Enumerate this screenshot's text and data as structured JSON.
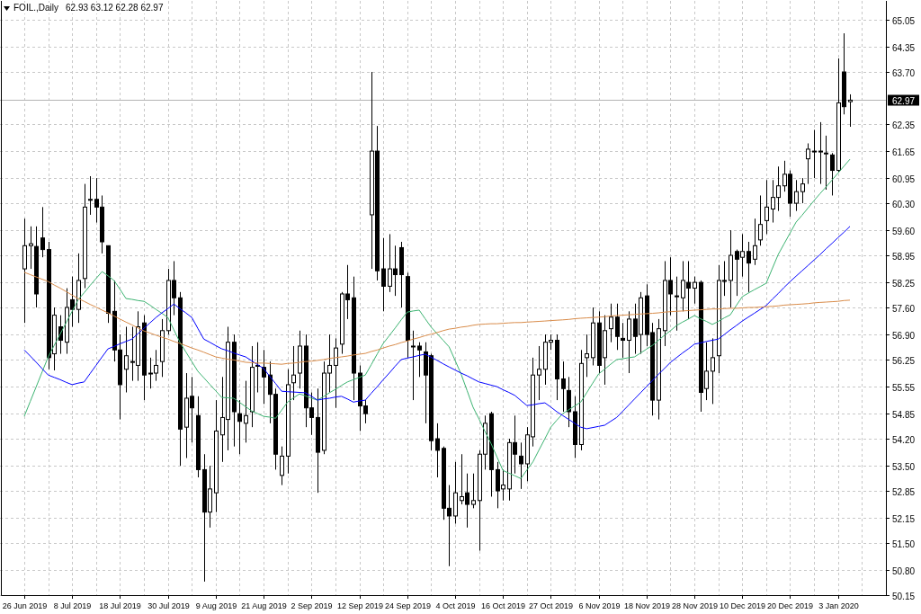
{
  "chart": {
    "header": {
      "symbol": "FOIL.,Daily",
      "quote": "62.93 63.12 62.28 62.97"
    },
    "chart_data": {
      "type": "candlestick",
      "grid": true,
      "ylim": [
        50.15,
        65.54
      ],
      "categories": [
        "26 Jun 2019",
        null,
        null,
        null,
        null,
        null,
        null,
        null,
        "8 Jul 2019",
        null,
        null,
        null,
        null,
        null,
        null,
        null,
        "18 Jul 2019",
        null,
        null,
        null,
        null,
        null,
        null,
        null,
        "30 Jul 2019",
        null,
        null,
        null,
        null,
        null,
        null,
        null,
        "9 Aug 2019",
        null,
        null,
        null,
        null,
        null,
        null,
        null,
        "21 Aug 2019",
        null,
        null,
        null,
        null,
        null,
        null,
        null,
        "2 Sep 2019",
        null,
        null,
        null,
        null,
        null,
        null,
        null,
        "12 Sep 2019",
        null,
        null,
        null,
        null,
        null,
        null,
        null,
        "24 Sep 2019",
        null,
        null,
        null,
        null,
        null,
        null,
        null,
        "4 Oct 2019",
        null,
        null,
        null,
        null,
        null,
        null,
        null,
        "16 Oct 2019",
        null,
        null,
        null,
        null,
        null,
        null,
        null,
        "27 Oct 2019",
        null,
        null,
        null,
        null,
        null,
        null,
        null,
        "6 Nov 2019",
        null,
        null,
        null,
        null,
        null,
        null,
        null,
        "18 Nov 2019",
        null,
        null,
        null,
        null,
        null,
        null,
        null,
        "28 Nov 2019",
        null,
        null,
        null,
        null,
        null,
        null,
        null,
        "10 Dec 2019",
        null,
        null,
        null,
        null,
        null,
        null,
        null,
        "20 Dec 2019",
        null,
        null,
        null,
        null,
        null,
        null,
        null,
        "3 Jan 2020",
        null,
        null
      ],
      "yticks": [
        {
          "value": 65.05,
          "label": "65.05"
        },
        {
          "value": 64.35,
          "label": "64.35"
        },
        {
          "value": 63.7,
          "label": "63.70"
        },
        {
          "value": 62.35,
          "label": "62.35"
        },
        {
          "value": 61.65,
          "label": "61.65"
        },
        {
          "value": 60.95,
          "label": "60.95"
        },
        {
          "value": 60.3,
          "label": "60.30"
        },
        {
          "value": 59.6,
          "label": "59.60"
        },
        {
          "value": 58.95,
          "label": "58.95"
        },
        {
          "value": 58.25,
          "label": "58.25"
        },
        {
          "value": 57.6,
          "label": "57.60"
        },
        {
          "value": 56.9,
          "label": "56.90"
        },
        {
          "value": 56.25,
          "label": "56.25"
        },
        {
          "value": 55.55,
          "label": "55.55"
        },
        {
          "value": 54.85,
          "label": "54.85"
        },
        {
          "value": 54.2,
          "label": "54.20"
        },
        {
          "value": 53.5,
          "label": "53.50"
        },
        {
          "value": 52.85,
          "label": "52.85"
        },
        {
          "value": 52.15,
          "label": "52.15"
        },
        {
          "value": 51.5,
          "label": "51.50"
        },
        {
          "value": 50.8,
          "label": "50.80"
        },
        {
          "value": 50.15,
          "label": "50.15"
        }
      ],
      "ref_lines": [
        {
          "axis": "y",
          "value": 62.97,
          "label": "62.97"
        }
      ],
      "ohlc": [
        [
          58.6,
          59.9,
          57.2,
          59.2
        ],
        [
          59.2,
          59.7,
          58.6,
          59.25
        ],
        [
          59.18,
          59.7,
          57.6,
          57.95
        ],
        [
          59.4,
          60.2,
          58.9,
          59.1
        ],
        [
          59.1,
          59.3,
          56.0,
          56.3
        ],
        [
          56.4,
          57.6,
          55.97,
          57.4
        ],
        [
          57.1,
          57.4,
          56.4,
          56.75
        ],
        [
          56.7,
          58.1,
          56.4,
          57.6
        ],
        [
          57.8,
          58.4,
          57.1,
          57.55
        ],
        [
          57.55,
          59.0,
          57.2,
          58.3
        ],
        [
          58.35,
          60.8,
          58.1,
          60.2
        ],
        [
          60.4,
          61.0,
          60.0,
          60.4
        ],
        [
          60.4,
          60.95,
          59.8,
          60.2
        ],
        [
          60.2,
          60.5,
          59.0,
          59.3
        ],
        [
          59.2,
          59.2,
          57.2,
          57.45
        ],
        [
          57.5,
          58.3,
          56.2,
          56.5
        ],
        [
          56.5,
          56.9,
          54.7,
          55.6
        ],
        [
          56.0,
          57.1,
          55.4,
          56.35
        ],
        [
          56.2,
          57.1,
          55.7,
          56.2
        ],
        [
          56.1,
          57.5,
          55.7,
          57.1
        ],
        [
          57.2,
          57.4,
          55.2,
          55.85
        ],
        [
          55.9,
          56.3,
          55.5,
          55.9
        ],
        [
          55.9,
          56.5,
          55.7,
          56.1
        ],
        [
          56.2,
          57.3,
          55.8,
          57.0
        ],
        [
          57.0,
          58.6,
          56.9,
          58.3
        ],
        [
          58.3,
          58.8,
          57.4,
          57.85
        ],
        [
          57.85,
          58.0,
          53.5,
          54.45
        ],
        [
          54.5,
          55.9,
          53.7,
          55.25
        ],
        [
          55.3,
          55.8,
          54.1,
          55.0
        ],
        [
          54.8,
          55.3,
          53.2,
          53.4
        ],
        [
          53.4,
          53.8,
          50.5,
          52.3
        ],
        [
          52.3,
          53.5,
          51.9,
          52.9
        ],
        [
          52.8,
          55.2,
          52.3,
          54.4
        ],
        [
          54.3,
          55.8,
          53.6,
          54.75
        ],
        [
          54.7,
          57.1,
          53.9,
          56.7
        ],
        [
          56.7,
          56.9,
          54.0,
          54.9
        ],
        [
          54.85,
          55.2,
          53.8,
          54.65
        ],
        [
          54.6,
          55.7,
          54.1,
          54.8
        ],
        [
          54.9,
          56.6,
          54.5,
          56.05
        ],
        [
          56.1,
          56.7,
          55.4,
          56.1
        ],
        [
          56.05,
          56.5,
          55.1,
          55.8
        ],
        [
          55.85,
          56.2,
          54.6,
          55.35
        ],
        [
          55.35,
          55.5,
          53.4,
          53.8
        ],
        [
          53.25,
          54.0,
          53.0,
          53.75
        ],
        [
          53.75,
          56.0,
          53.3,
          55.6
        ],
        [
          55.65,
          56.6,
          55.2,
          55.85
        ],
        [
          55.9,
          57.0,
          55.5,
          56.6
        ],
        [
          56.6,
          56.9,
          54.5,
          55.0
        ],
        [
          55.0,
          55.4,
          54.3,
          54.75
        ],
        [
          54.75,
          55.5,
          52.8,
          53.85
        ],
        [
          53.9,
          56.2,
          53.8,
          55.9
        ],
        [
          55.9,
          56.9,
          55.4,
          56.1
        ],
        [
          56.1,
          56.8,
          55.0,
          56.55
        ],
        [
          56.65,
          58.0,
          56.4,
          57.95
        ],
        [
          57.95,
          58.7,
          57.3,
          57.8
        ],
        [
          57.85,
          58.4,
          55.2,
          55.9
        ],
        [
          55.9,
          56.1,
          54.4,
          55.05
        ],
        [
          55.05,
          55.2,
          54.6,
          54.85
        ],
        [
          60.0,
          63.7,
          58.6,
          61.65
        ],
        [
          61.65,
          62.3,
          58.3,
          58.55
        ],
        [
          58.6,
          59.4,
          57.5,
          58.15
        ],
        [
          58.15,
          59.5,
          58.0,
          58.6
        ],
        [
          58.6,
          59.2,
          57.9,
          58.45
        ],
        [
          59.15,
          59.3,
          57.6,
          58.45
        ],
        [
          58.4,
          58.5,
          56.3,
          56.75
        ],
        [
          56.6,
          57.0,
          55.2,
          56.6
        ],
        [
          56.6,
          56.7,
          55.8,
          56.5
        ],
        [
          56.45,
          56.7,
          54.6,
          55.85
        ],
        [
          56.35,
          56.4,
          53.9,
          54.15
        ],
        [
          54.2,
          54.6,
          53.2,
          53.9
        ],
        [
          53.95,
          54.0,
          52.1,
          52.4
        ],
        [
          52.4,
          53.0,
          50.9,
          52.2
        ],
        [
          52.2,
          53.6,
          52.0,
          52.8
        ],
        [
          52.6,
          53.8,
          52.5,
          52.7
        ],
        [
          52.8,
          53.3,
          51.9,
          52.5
        ],
        [
          52.5,
          53.3,
          52.4,
          52.6
        ],
        [
          52.6,
          53.9,
          51.3,
          53.8
        ],
        [
          53.8,
          54.8,
          53.4,
          54.6
        ],
        [
          54.85,
          54.9,
          52.7,
          53.4
        ],
        [
          53.4,
          53.6,
          52.4,
          52.85
        ],
        [
          52.9,
          53.4,
          52.6,
          53.0
        ],
        [
          52.9,
          54.2,
          52.6,
          54.1
        ],
        [
          54.1,
          54.8,
          53.3,
          53.8
        ],
        [
          53.75,
          54.1,
          52.9,
          53.55
        ],
        [
          53.55,
          54.5,
          53.1,
          54.3
        ],
        [
          54.25,
          56.3,
          54.0,
          55.85
        ],
        [
          55.85,
          56.6,
          55.2,
          56.0
        ],
        [
          56.0,
          56.9,
          55.6,
          56.7
        ],
        [
          56.7,
          56.9,
          56.5,
          56.75
        ],
        [
          56.75,
          56.9,
          55.2,
          55.75
        ],
        [
          55.75,
          56.2,
          54.9,
          55.5
        ],
        [
          55.45,
          55.8,
          54.5,
          54.9
        ],
        [
          54.9,
          55.3,
          53.7,
          54.05
        ],
        [
          54.05,
          56.5,
          53.9,
          56.15
        ],
        [
          56.3,
          56.9,
          55.8,
          56.4
        ],
        [
          56.3,
          57.6,
          56.1,
          57.2
        ],
        [
          57.2,
          57.5,
          55.9,
          56.1
        ],
        [
          56.3,
          57.4,
          55.6,
          57.0
        ],
        [
          57.05,
          57.7,
          56.7,
          57.35
        ],
        [
          57.35,
          57.7,
          56.5,
          56.85
        ],
        [
          56.8,
          57.2,
          56.3,
          56.75
        ],
        [
          56.75,
          57.5,
          55.9,
          57.3
        ],
        [
          57.3,
          57.7,
          56.4,
          56.85
        ],
        [
          56.9,
          58.0,
          56.4,
          57.85
        ],
        [
          57.9,
          58.2,
          56.6,
          56.9
        ],
        [
          56.95,
          57.2,
          54.8,
          55.2
        ],
        [
          55.2,
          57.3,
          54.7,
          57.05
        ],
        [
          57.0,
          58.8,
          56.6,
          58.3
        ],
        [
          58.3,
          58.9,
          57.4,
          57.95
        ],
        [
          57.9,
          58.4,
          57.0,
          57.9
        ],
        [
          57.85,
          58.8,
          57.5,
          58.3
        ],
        [
          58.25,
          58.8,
          57.3,
          58.1
        ],
        [
          58.1,
          58.4,
          57.7,
          58.25
        ],
        [
          58.25,
          58.3,
          54.9,
          55.4
        ],
        [
          55.5,
          56.7,
          55.2,
          55.95
        ],
        [
          55.95,
          56.8,
          55.1,
          56.3
        ],
        [
          56.35,
          58.7,
          55.9,
          58.3
        ],
        [
          58.3,
          58.8,
          57.9,
          58.3
        ],
        [
          58.3,
          59.6,
          57.6,
          58.95
        ],
        [
          59.05,
          59.1,
          57.9,
          58.85
        ],
        [
          58.9,
          59.5,
          58.4,
          59.05
        ],
        [
          59.05,
          59.3,
          58.0,
          58.75
        ],
        [
          58.85,
          59.9,
          58.7,
          59.2
        ],
        [
          59.35,
          60.5,
          59.2,
          59.75
        ],
        [
          59.85,
          60.9,
          59.5,
          60.2
        ],
        [
          60.15,
          60.9,
          59.8,
          60.45
        ],
        [
          60.45,
          61.25,
          60.1,
          60.75
        ],
        [
          60.75,
          61.4,
          60.6,
          61.05
        ],
        [
          61.05,
          61.15,
          59.95,
          60.3
        ],
        [
          60.3,
          60.9,
          60.1,
          60.6
        ],
        [
          60.6,
          60.95,
          60.3,
          60.8
        ],
        [
          61.45,
          61.85,
          60.8,
          61.7
        ],
        [
          61.65,
          62.2,
          60.95,
          61.65
        ],
        [
          61.65,
          62.4,
          60.8,
          61.65
        ],
        [
          61.6,
          62.05,
          60.65,
          61.6
        ],
        [
          61.55,
          61.6,
          60.5,
          61.15
        ],
        [
          61.15,
          64.05,
          61.1,
          62.9
        ],
        [
          63.7,
          64.7,
          62.6,
          62.8
        ],
        [
          62.93,
          63.12,
          62.28,
          62.97
        ]
      ],
      "series": [
        {
          "type": "line",
          "color": "#3cb371",
          "values": [
            54.78,
            55.17,
            55.55,
            55.94,
            56.32,
            56.62,
            56.91,
            57.21,
            57.5,
            57.8,
            57.98,
            58.17,
            58.35,
            58.53,
            58.42,
            58.3,
            58.07,
            57.83,
            57.81,
            57.78,
            57.76,
            57.66,
            57.55,
            57.45,
            57.34,
            57.02,
            56.7,
            56.45,
            56.2,
            55.95,
            55.78,
            55.61,
            55.44,
            55.27,
            55.26,
            55.25,
            55.14,
            55.03,
            54.92,
            54.85,
            54.78,
            54.76,
            54.73,
            54.94,
            55.15,
            55.26,
            55.36,
            55.31,
            55.25,
            55.2,
            55.29,
            55.39,
            55.48,
            55.58,
            55.67,
            55.73,
            55.79,
            55.85,
            56.12,
            56.4,
            56.67,
            56.87,
            57.07,
            57.28,
            57.48,
            57.51,
            57.53,
            57.31,
            57.09,
            56.92,
            56.75,
            56.58,
            56.23,
            55.88,
            55.45,
            55.02,
            54.71,
            54.39,
            54.08,
            53.73,
            53.38,
            53.31,
            53.24,
            53.17,
            53.39,
            53.6,
            53.9,
            54.2,
            54.5,
            54.68,
            54.85,
            54.95,
            55.05,
            55.15,
            55.39,
            55.64,
            55.88,
            56.0,
            56.13,
            56.25,
            56.27,
            56.3,
            56.32,
            56.42,
            56.52,
            56.62,
            56.75,
            56.88,
            57.0,
            57.13,
            57.22,
            57.3,
            57.39,
            57.31,
            57.24,
            57.16,
            57.24,
            57.33,
            57.41,
            57.65,
            57.88,
            57.97,
            58.06,
            58.14,
            58.23,
            58.6,
            58.97,
            59.25,
            59.53,
            59.81,
            59.99,
            60.18,
            60.37,
            60.55,
            60.72,
            60.9,
            61.08,
            61.26,
            61.44
          ]
        },
        {
          "type": "line",
          "color": "#0000ff",
          "values": [
            56.5,
            56.34,
            56.18,
            56.01,
            55.85,
            55.79,
            55.73,
            55.66,
            55.6,
            55.64,
            55.67,
            55.89,
            56.1,
            56.32,
            56.53,
            56.59,
            56.66,
            56.72,
            56.78,
            56.92,
            57.06,
            57.2,
            57.34,
            57.46,
            57.57,
            57.69,
            57.57,
            57.46,
            57.34,
            57.06,
            56.78,
            56.7,
            56.61,
            56.53,
            56.48,
            56.42,
            56.37,
            56.32,
            56.22,
            56.12,
            56.02,
            55.82,
            55.63,
            55.43,
            55.42,
            55.41,
            55.4,
            55.39,
            55.3,
            55.2,
            55.23,
            55.25,
            55.28,
            55.3,
            55.23,
            55.15,
            55.18,
            55.2,
            55.38,
            55.55,
            55.73,
            55.9,
            56.08,
            56.25,
            56.29,
            56.32,
            56.36,
            56.39,
            56.31,
            56.23,
            56.14,
            56.06,
            55.98,
            55.9,
            55.83,
            55.75,
            55.67,
            55.63,
            55.59,
            55.55,
            55.47,
            55.4,
            55.32,
            55.19,
            55.06,
            55.08,
            55.11,
            55.13,
            55.02,
            54.9,
            54.8,
            54.7,
            54.6,
            54.5,
            54.46,
            54.49,
            54.52,
            54.55,
            54.65,
            54.75,
            54.91,
            55.07,
            55.23,
            55.39,
            55.55,
            55.71,
            55.87,
            56.02,
            56.18,
            56.3,
            56.42,
            56.53,
            56.65,
            56.68,
            56.72,
            56.75,
            56.78,
            56.9,
            57.02,
            57.13,
            57.25,
            57.35,
            57.45,
            57.55,
            57.65,
            57.81,
            57.96,
            58.12,
            58.27,
            58.41,
            58.55,
            58.69,
            58.83,
            58.97,
            59.12,
            59.26,
            59.41,
            59.55,
            59.7
          ]
        },
        {
          "type": "line",
          "color": "#d98c4a",
          "values": [
            58.51,
            58.45,
            58.39,
            58.33,
            58.27,
            58.18,
            58.1,
            58.01,
            57.92,
            57.83,
            57.76,
            57.68,
            57.61,
            57.53,
            57.46,
            57.38,
            57.3,
            57.22,
            57.15,
            57.07,
            56.99,
            56.94,
            56.88,
            56.83,
            56.78,
            56.72,
            56.67,
            56.61,
            56.55,
            56.5,
            56.44,
            56.38,
            56.32,
            56.29,
            56.26,
            56.24,
            56.21,
            56.18,
            56.17,
            56.16,
            56.16,
            56.15,
            56.14,
            56.13,
            56.15,
            56.16,
            56.18,
            56.2,
            56.21,
            56.23,
            56.25,
            56.28,
            56.3,
            56.32,
            56.34,
            56.37,
            56.39,
            56.41,
            56.46,
            56.5,
            56.55,
            56.6,
            56.64,
            56.69,
            56.73,
            56.78,
            56.82,
            56.87,
            56.91,
            56.95,
            57.0,
            57.04,
            57.06,
            57.09,
            57.11,
            57.14,
            57.16,
            57.17,
            57.18,
            57.18,
            57.19,
            57.2,
            57.21,
            57.21,
            57.22,
            57.23,
            57.24,
            57.25,
            57.26,
            57.27,
            57.28,
            57.29,
            57.31,
            57.32,
            57.33,
            57.34,
            57.35,
            57.36,
            57.38,
            57.39,
            57.4,
            57.41,
            57.42,
            57.43,
            57.44,
            57.45,
            57.46,
            57.48,
            57.49,
            57.5,
            57.51,
            57.52,
            57.53,
            57.54,
            57.55,
            57.56,
            57.56,
            57.57,
            57.58,
            57.58,
            57.59,
            57.6,
            57.6,
            57.61,
            57.62,
            57.63,
            57.64,
            57.66,
            57.67,
            57.68,
            57.69,
            57.7,
            57.72,
            57.73,
            57.74,
            57.75,
            57.76,
            57.78,
            57.79
          ]
        }
      ]
    }
  }
}
